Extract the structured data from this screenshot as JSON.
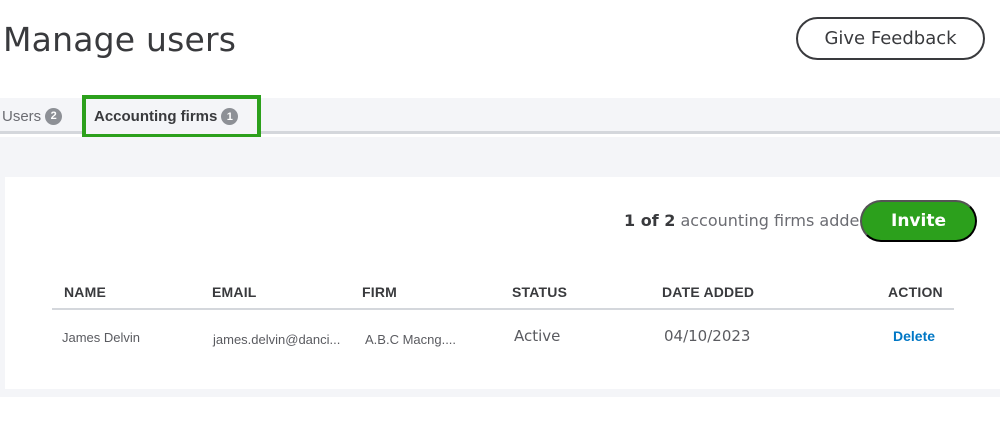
{
  "header": {
    "title": "Manage users",
    "feedback_label": "Give Feedback"
  },
  "tabs": [
    {
      "label": "Users",
      "badge": "2",
      "active": false
    },
    {
      "label": "Accounting firms",
      "badge": "1",
      "active": true
    }
  ],
  "summary": {
    "count": "1 of 2",
    "suffix": "accounting firms added"
  },
  "actions": {
    "invite_label": "Invite"
  },
  "table": {
    "columns": [
      "NAME",
      "EMAIL",
      "FIRM",
      "STATUS",
      "DATE ADDED",
      "ACTION"
    ],
    "rows": [
      {
        "name": "James Delvin",
        "email": "james.delvin@danci...",
        "firm": "A.B.C Macng....",
        "status": "Active",
        "date_added": "04/10/2023",
        "action": "Delete"
      }
    ]
  },
  "colors": {
    "accent_green": "#2ca01c",
    "link_blue": "#0077c5",
    "text_dark": "#393a3d",
    "surface_gray": "#f4f5f8"
  }
}
